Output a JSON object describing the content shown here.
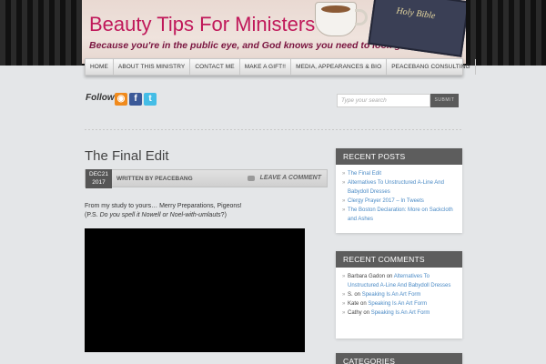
{
  "site": {
    "title": "Beauty Tips For Ministers",
    "tagline": "Because you're in the public eye, and God knows you need to look good.",
    "bible_text": "Holy Bible"
  },
  "nav": {
    "items": [
      "HOME",
      "ABOUT THIS MINISTRY",
      "CONTACT ME",
      "MAKE A GIFT!!",
      "MEDIA, APPEARANCES & BIO",
      "PEACEBANG CONSULTING"
    ]
  },
  "follow": {
    "label": "Follow",
    "icons": [
      "rss-icon",
      "facebook-icon",
      "twitter-icon"
    ]
  },
  "search": {
    "placeholder": "Type your search",
    "button": "SUBMIT"
  },
  "post": {
    "title": "The Final Edit",
    "date_month_day": "DEC21",
    "date_year": "2017",
    "author": "WRITTEN BY PEACEBANG",
    "leave_comment": "LEAVE A COMMENT",
    "line1": "From my study to yours… Merry Preparations, Pigeons!",
    "line2_prefix": "(P.S.",
    "line2_italic": "Do you spell it Nowell or Noel-with-umlauts",
    "line2_suffix": "?)"
  },
  "sidebar": {
    "recent_posts": {
      "title": "RECENT POSTS",
      "items": [
        "The Final Edit",
        "Alternatives To Unstructured A-Line And Babydoll Dresses",
        "Clergy Prayer 2017 – In Tweets",
        "The Boston Declaration: More on Sackcloth and Ashes"
      ]
    },
    "recent_comments": {
      "title": "RECENT COMMENTS",
      "items": [
        {
          "author": "Barbara Gadon",
          "on": "on",
          "post": "Alternatives To Unstructured A-Line And Babydoll Dresses"
        },
        {
          "author": "S.",
          "on": "on",
          "post": "Speaking Is An Art Form"
        },
        {
          "author": "Kate",
          "on": "on",
          "post": "Speaking Is An Art Form"
        },
        {
          "author": "Cathy",
          "on": "on",
          "post": "Speaking Is An Art Form"
        }
      ]
    },
    "categories": {
      "title": "CATEGORIES"
    }
  },
  "colors": {
    "title_pink": "#c0185a",
    "link_blue": "#4a8ac5",
    "widget_header": "#5d5d5d"
  }
}
